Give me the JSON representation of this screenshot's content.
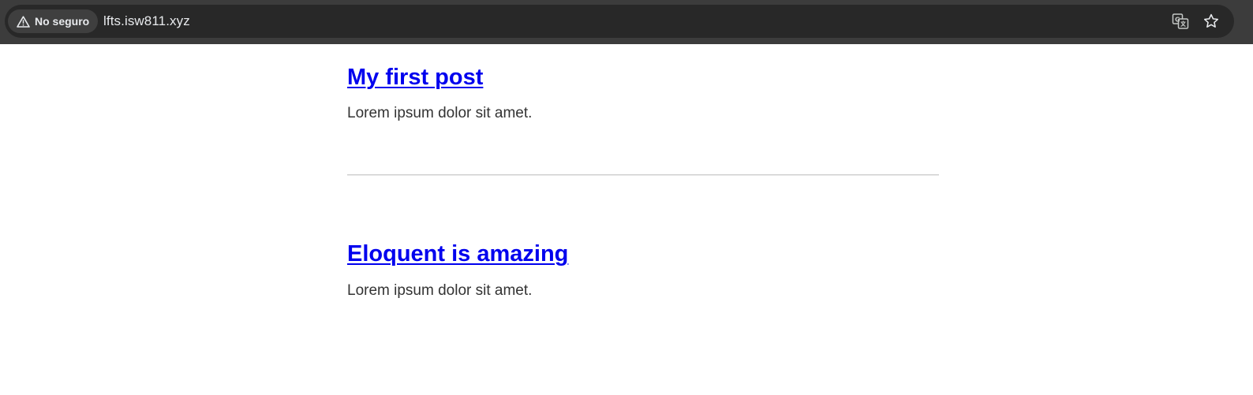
{
  "browser": {
    "security_label": "No seguro",
    "url": "lfts.isw811.xyz",
    "icons": [
      "warning-icon",
      "translate-icon",
      "star-icon"
    ]
  },
  "posts": [
    {
      "title": "My first post",
      "body": "Lorem ipsum dolor sit amet."
    },
    {
      "title": "Eloquent is amazing",
      "body": "Lorem ipsum dolor sit amet."
    }
  ],
  "colors": {
    "link": "#0000ee",
    "body_text": "#333333",
    "toolbar": "#3c3c3c",
    "omnibox": "#282828"
  }
}
